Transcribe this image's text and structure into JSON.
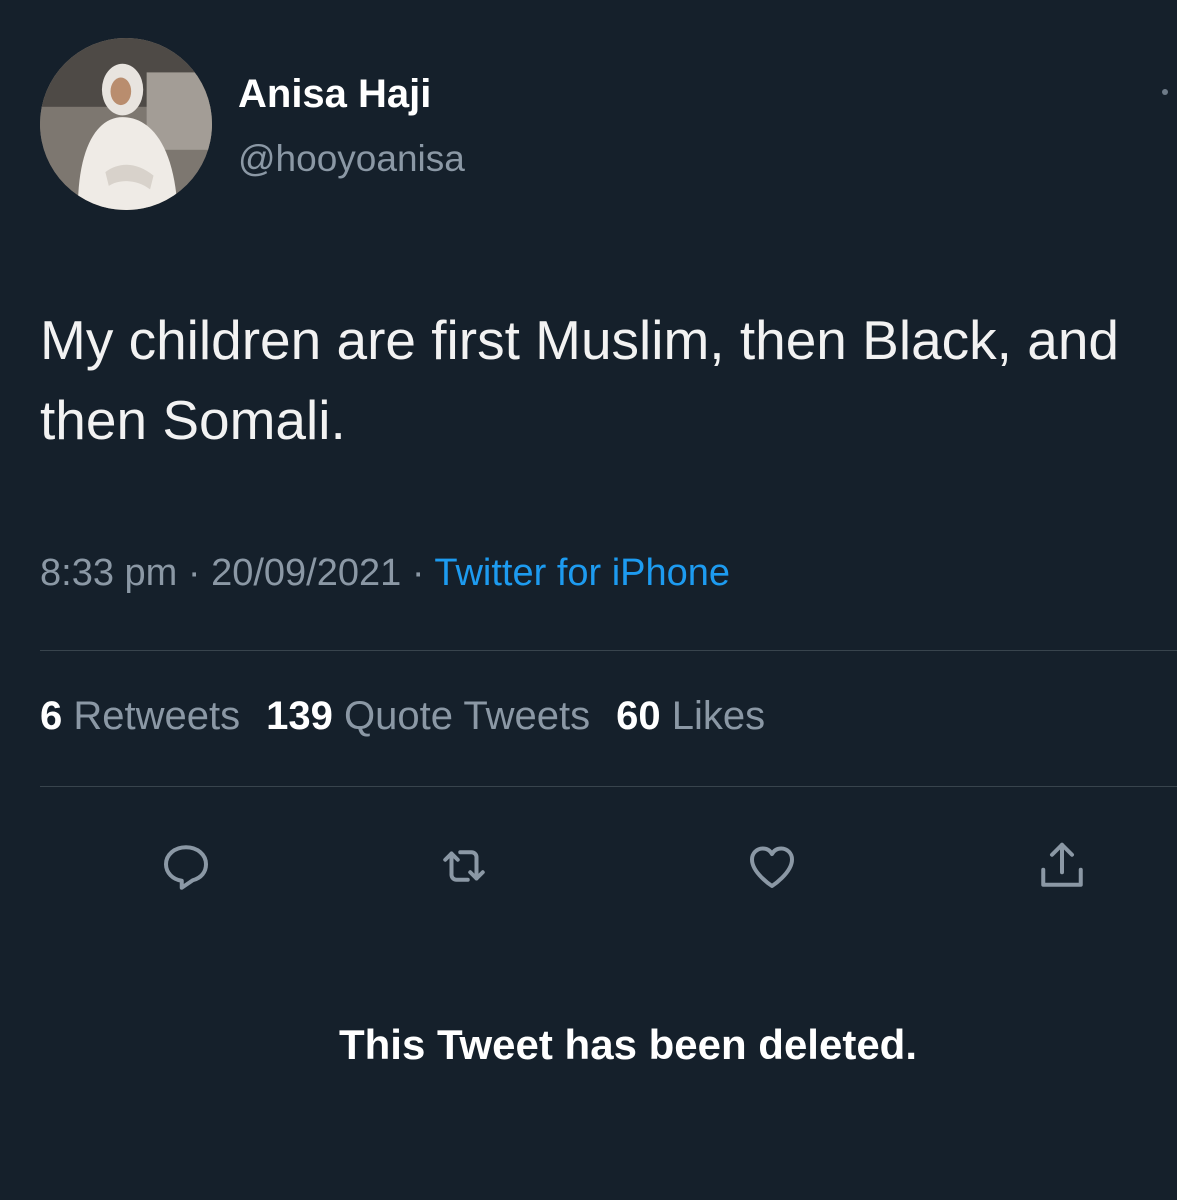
{
  "user": {
    "display_name": "Anisa Haji",
    "handle": "@hooyoanisa"
  },
  "tweet": {
    "text": "My children are first Muslim, then Black, and then Somali.",
    "time": "8:33 pm",
    "separator": "·",
    "date": "20/09/2021",
    "source": "Twitter for iPhone"
  },
  "stats": {
    "retweets_count": "6",
    "retweets_label": "Retweets",
    "quotes_count": "139",
    "quotes_label": "Quote Tweets",
    "likes_count": "60",
    "likes_label": "Likes"
  },
  "actions": [
    "reply-icon",
    "retweet-icon",
    "like-icon",
    "share-icon"
  ],
  "notice": "This Tweet has been deleted.",
  "colors": {
    "background": "#15202b",
    "link": "#1d9bf0",
    "muted": "#8b98a5"
  }
}
